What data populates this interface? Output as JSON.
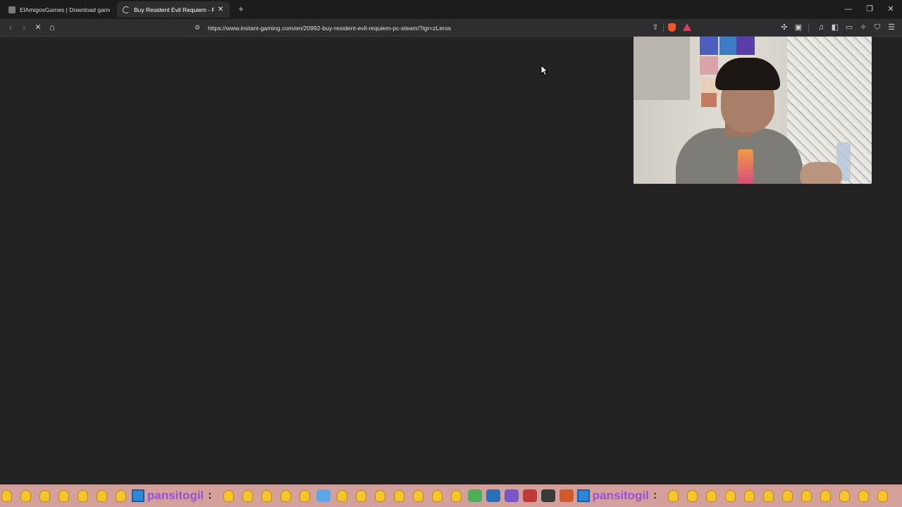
{
  "browser": {
    "tabs": [
      {
        "title": "ElAmigosGames | Download games f",
        "icon": "site-favicon",
        "active": false
      },
      {
        "title": "Buy Resident Evil Requiem - PC (",
        "icon": "loading-spinner",
        "active": true
      }
    ],
    "new_tab_glyph": "+",
    "close_glyph": "✕",
    "window_controls": {
      "minimize": "—",
      "restore": "❐",
      "close": "✕"
    },
    "nav": {
      "back": "‹",
      "forward": "›",
      "stop": "✕",
      "home": "⌂"
    },
    "url": "https://www.instant-gaming.com/en/20992-buy-resident-evil-requiem-pc-steam/?igr=zLeros",
    "url_icon": "site-info-icon",
    "toolbar_icons": [
      "share-icon",
      "brave-shields-icon",
      "brave-rewards-icon",
      "extensions-icon",
      "screenshot-icon",
      "media-icon",
      "sidebar-icon",
      "wallet-icon",
      "leo-icon",
      "vpn-icon",
      "menu-icon"
    ],
    "accent_colors": {
      "brave": "#fb542b",
      "rewards": "#e33a5a"
    }
  },
  "page": {
    "background": "#232323",
    "state": "loading"
  },
  "overlay": {
    "webcam": "streamer-webcam",
    "chat": {
      "username": "pansitogil",
      "separator": ":",
      "background": "#d4a09c",
      "user_color": "#9b4fd6",
      "emote": "clapping-hands-emote"
    }
  }
}
